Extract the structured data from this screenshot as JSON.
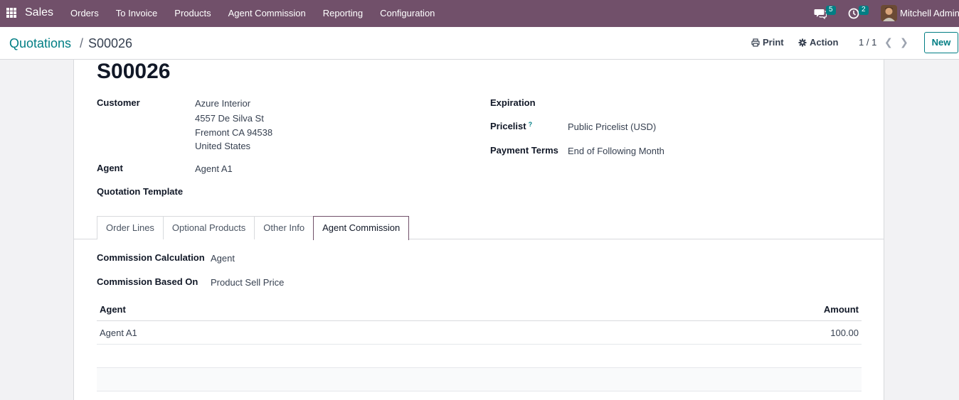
{
  "navbar": {
    "app_name": "Sales",
    "menu": [
      "Orders",
      "To Invoice",
      "Products",
      "Agent Commission",
      "Reporting",
      "Configuration"
    ],
    "messages_count": "5",
    "activities_count": "2",
    "user_name": "Mitchell Admin",
    "bg_color": "#71506a"
  },
  "breadcrumb": {
    "parent": "Quotations",
    "separator": "/",
    "current": "S00026"
  },
  "toolbar": {
    "print_label": "Print",
    "action_label": "Action",
    "pager": "1 / 1",
    "new_label": "New"
  },
  "record": {
    "title": "S00026",
    "customer_label": "Customer",
    "customer_lines": [
      "Azure Interior",
      "4557 De Silva St",
      "Fremont CA 94538",
      "United States"
    ],
    "agent_label": "Agent",
    "agent_value": "Agent A1",
    "template_label": "Quotation Template",
    "expiration_label": "Expiration",
    "pricelist_label": "Pricelist",
    "pricelist_help": "?",
    "pricelist_value": "Public Pricelist (USD)",
    "payment_terms_label": "Payment Terms",
    "payment_terms_value": "End of Following Month"
  },
  "tabs": [
    {
      "label": "Order Lines",
      "active": false
    },
    {
      "label": "Optional Products",
      "active": false
    },
    {
      "label": "Other Info",
      "active": false
    },
    {
      "label": "Agent Commission",
      "active": true
    }
  ],
  "commission": {
    "calc_label": "Commission Calculation",
    "calc_value": "Agent",
    "based_on_label": "Commission Based On",
    "based_on_value": "Product Sell Price",
    "table": {
      "headers": [
        "Agent",
        "Amount"
      ],
      "rows": [
        [
          "Agent A1",
          "100.00"
        ]
      ]
    }
  },
  "colors": {
    "accent": "#017e84",
    "brand": "#71506a"
  }
}
